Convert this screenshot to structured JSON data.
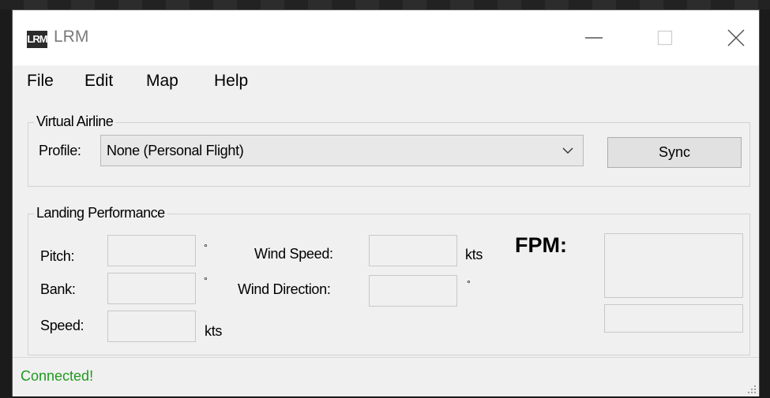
{
  "window": {
    "title": "LRM",
    "logo_text": "LRM"
  },
  "titlebar_icons": [
    "minimize-icon",
    "maximize-icon",
    "close-icon"
  ],
  "menu": {
    "items": [
      "File",
      "Edit",
      "Map",
      "Help"
    ]
  },
  "virtual_airline": {
    "legend": "Virtual Airline",
    "profile_label": "Profile:",
    "profile_value": "None (Personal Flight)",
    "sync_label": "Sync"
  },
  "landing": {
    "legend": "Landing Performance",
    "pitch_label": "Pitch:",
    "bank_label": "Bank:",
    "speed_label": "Speed:",
    "wind_speed_label": "Wind Speed:",
    "wind_direction_label": "Wind Direction:",
    "degree_symbol": "°",
    "kts_unit": "kts",
    "fpm_label": "FPM:",
    "values": {
      "pitch": "",
      "bank": "",
      "speed": "",
      "wind_speed": "",
      "wind_direction": "",
      "fpm": "",
      "fpm_secondary": ""
    }
  },
  "status": {
    "text": "Connected!",
    "color": "#1e9a1e"
  }
}
